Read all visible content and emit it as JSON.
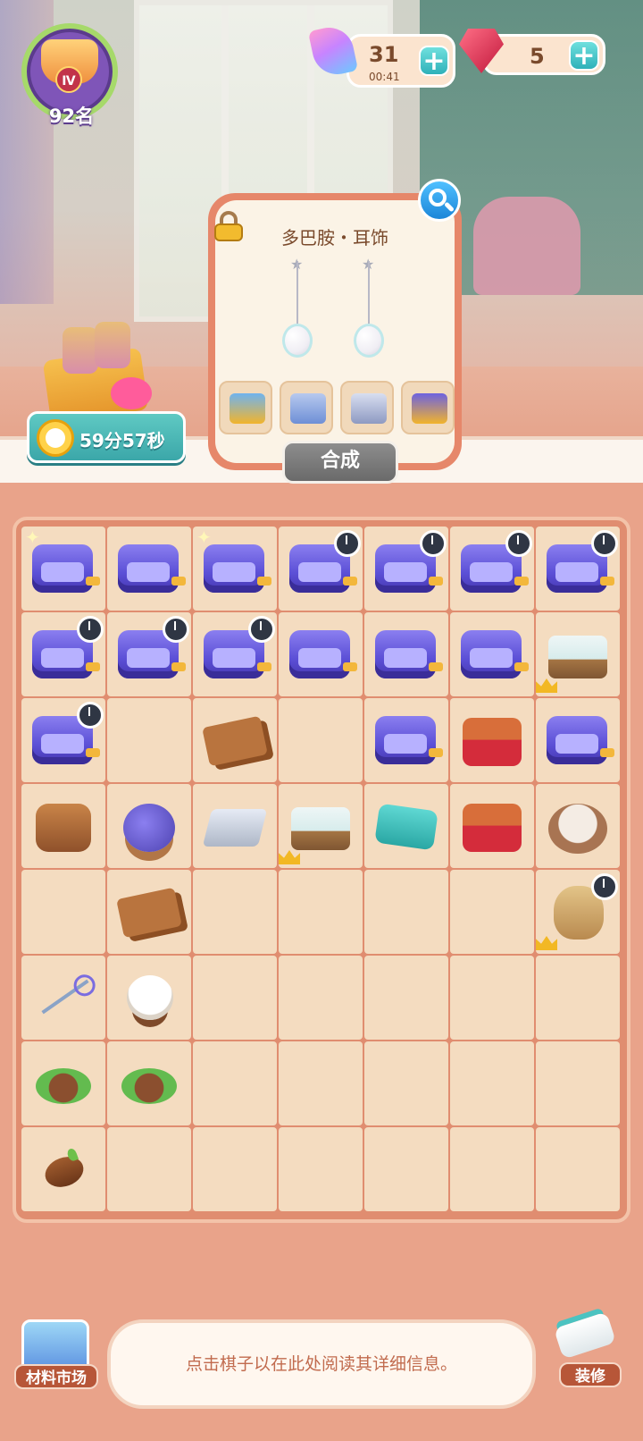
{
  "player": {
    "rank": "92名",
    "level_badge": "Ⅳ"
  },
  "currency": {
    "energy": {
      "value": "31",
      "timer": "00:41",
      "add_label": "+"
    },
    "gems": {
      "value": "5",
      "add_label": "+"
    }
  },
  "event": {
    "timer": "59分57秒"
  },
  "item_detail": {
    "title": "多巴胺・耳饰",
    "merge_button": "合成",
    "recipe": [
      "toolbox-icon",
      "sewing-kit-icon",
      "silver-ingot-icon",
      "sewing-machine-icon"
    ]
  },
  "board": {
    "columns": 7,
    "rows": [
      [
        "sewing-kit:spark",
        "sewing-kit",
        "sewing-kit:spark",
        "sewing-kit:timer",
        "sewing-kit:timer",
        "sewing-kit:timer",
        "sewing-kit:timer"
      ],
      [
        "sewing-kit:timer",
        "sewing-kit:timer",
        "sewing-kit:timer",
        "sewing-kit",
        "sewing-kit",
        "sewing-kit",
        "sprout-box:crown"
      ],
      [
        "sewing-kit:timer",
        "",
        "wood-planks",
        "",
        "sewing-kit",
        "red-case",
        "sewing-kit"
      ],
      [
        "wood-basket",
        "yarn-basket",
        "silver-bars",
        "sprout-box:crown",
        "teal-cloth",
        "red-case",
        "cloth-rolls"
      ],
      [
        "",
        "wood-planks",
        "",
        "",
        "",
        "",
        "sack:crown:timer"
      ],
      [
        "needle-thread",
        "cotton",
        "",
        "",
        "",
        "",
        ""
      ],
      [
        "seed-pot",
        "sprout-pot",
        "",
        "",
        "",
        "",
        ""
      ],
      [
        "seed",
        "",
        "",
        "",
        "",
        "",
        ""
      ]
    ]
  },
  "footer": {
    "market_label": "材料市场",
    "decorate_label": "装修",
    "hint": "点击棋子以在此处阅读其详细信息。"
  }
}
